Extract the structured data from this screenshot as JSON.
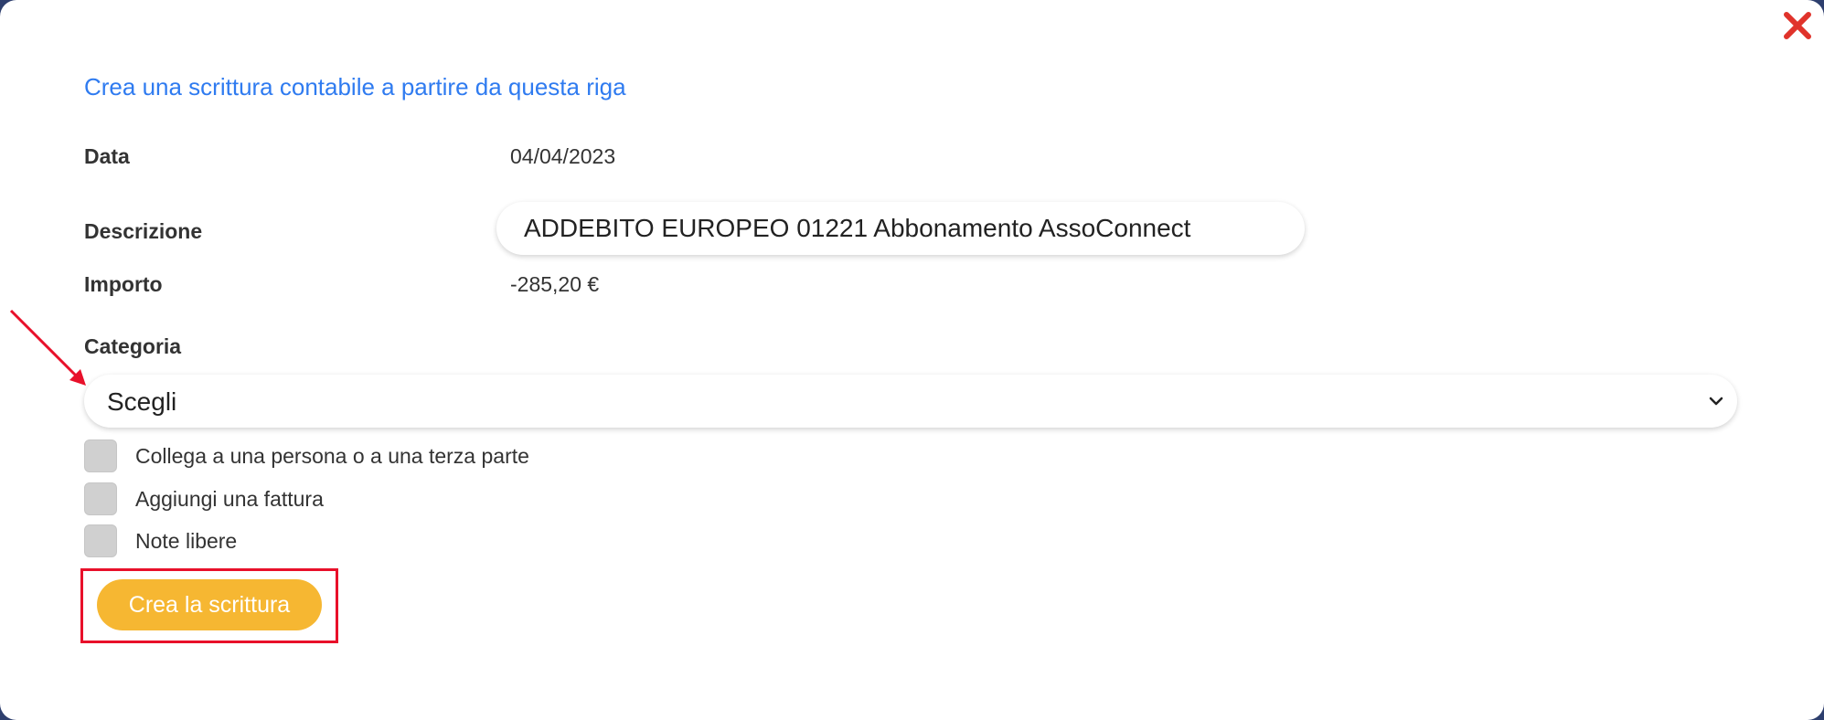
{
  "dialog": {
    "title": "Crea una scrittura contabile a partire da questa riga",
    "close_icon": "close-icon"
  },
  "fields": {
    "date": {
      "label": "Data",
      "value": "04/04/2023"
    },
    "description": {
      "label": "Descrizione",
      "value": "ADDEBITO EUROPEO 01221 Abbonamento AssoConnect"
    },
    "amount": {
      "label": "Importo",
      "value": "-285,20 €"
    },
    "category": {
      "label": "Categoria",
      "selected": "Scegli"
    }
  },
  "options": [
    {
      "label": "Collega a una persona o a una terza parte",
      "checked": false
    },
    {
      "label": "Aggiungi una fattura",
      "checked": false
    },
    {
      "label": "Note libere",
      "checked": false
    }
  ],
  "actions": {
    "create_label": "Crea la scrittura"
  },
  "colors": {
    "title": "#2f7bf0",
    "primary_button": "#f6b732",
    "close_icon": "#e0332b",
    "annotation": "#e8102a"
  }
}
